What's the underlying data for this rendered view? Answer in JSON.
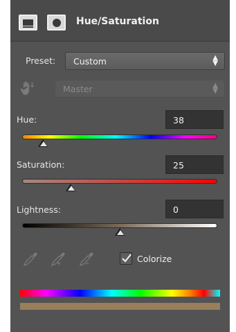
{
  "header": {
    "title": "Hue/Saturation"
  },
  "preset": {
    "label": "Preset:",
    "value": "Custom"
  },
  "channel": {
    "value": "Master",
    "enabled": false
  },
  "hue": {
    "label": "Hue:",
    "value": "38",
    "position": 0.11
  },
  "saturation": {
    "label": "Saturation:",
    "value": "25",
    "position": 0.25
  },
  "lightness": {
    "label": "Lightness:",
    "value": "0",
    "position": 0.5
  },
  "colorize": {
    "label": "Colorize",
    "checked": true
  },
  "colors": {
    "panel_bg": "#535353",
    "result_color": "#9a7f5c"
  }
}
